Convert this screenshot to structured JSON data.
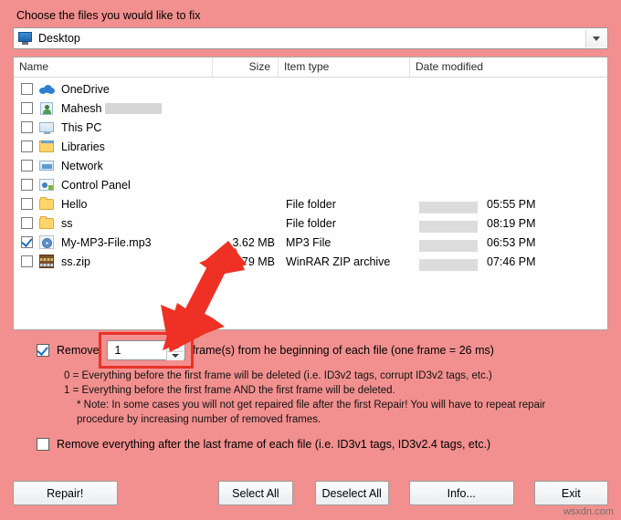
{
  "dialog": {
    "prompt": "Choose the files you would like to fix",
    "location": {
      "value": "Desktop",
      "icon": "monitor-icon",
      "dropdown_icon": "chevron-down-icon"
    },
    "columns": {
      "name": "Name",
      "size": "Size",
      "type": "Item type",
      "date": "Date modified"
    },
    "files": [
      {
        "checked": false,
        "icon": "onedrive-icon",
        "name": "OneDrive",
        "name_blurred": false,
        "size": "",
        "type": "",
        "date": "",
        "date_blurred": false
      },
      {
        "checked": false,
        "icon": "user-folder-icon",
        "name": "Mahesh",
        "name_blurred": true,
        "size": "",
        "type": "",
        "date": "",
        "date_blurred": false
      },
      {
        "checked": false,
        "icon": "this-pc-icon",
        "name": "This PC",
        "name_blurred": false,
        "size": "",
        "type": "",
        "date": "",
        "date_blurred": false
      },
      {
        "checked": false,
        "icon": "libraries-icon",
        "name": "Libraries",
        "name_blurred": false,
        "size": "",
        "type": "",
        "date": "",
        "date_blurred": false
      },
      {
        "checked": false,
        "icon": "network-icon",
        "name": "Network",
        "name_blurred": false,
        "size": "",
        "type": "",
        "date": "",
        "date_blurred": false
      },
      {
        "checked": false,
        "icon": "control-panel-icon",
        "name": "Control Panel",
        "name_blurred": false,
        "size": "",
        "type": "",
        "date": "",
        "date_blurred": false
      },
      {
        "checked": false,
        "icon": "folder-icon",
        "name": "Hello",
        "name_blurred": false,
        "size": "",
        "type": "File folder",
        "date": "05:55 PM",
        "date_blurred": true
      },
      {
        "checked": false,
        "icon": "folder-icon",
        "name": "ss",
        "name_blurred": false,
        "size": "",
        "type": "File folder",
        "date": "08:19 PM",
        "date_blurred": true
      },
      {
        "checked": true,
        "icon": "mp3-file-icon",
        "name": "My-MP3-File.mp3",
        "name_blurred": false,
        "size": "3.62 MB",
        "type": "MP3 File",
        "date": "06:53 PM",
        "date_blurred": true
      },
      {
        "checked": false,
        "icon": "zip-archive-icon",
        "name": "ss.zip",
        "name_blurred": false,
        "size": "2.79 MB",
        "type": "WinRAR ZIP archive",
        "date": "07:46 PM",
        "date_blurred": true
      }
    ],
    "remove_frames": {
      "checked": true,
      "label_before": "Remove",
      "value": "1",
      "label_after": "frame(s) from he beginning of each file (one frame = 26 ms)",
      "spinner_up_icon": "spinner-up-icon",
      "spinner_down_icon": "spinner-down-icon",
      "highlight_color": "#e8322a"
    },
    "notes": [
      "0 = Everything before the first frame will be deleted (i.e. ID3v2 tags, corrupt ID3v2 tags, etc.)",
      "1 = Everything before the first frame AND the first frame will be deleted.",
      "* Note: In some cases you will not get repaired file after the first Repair! You will have to repeat repair",
      "procedure by increasing number of removed frames."
    ],
    "remove_after_last": {
      "checked": false,
      "label": "Remove everything after the last frame of each file (i.e. ID3v1 tags, ID3v2.4 tags, etc.)"
    },
    "buttons": {
      "repair": "Repair!",
      "select_all": "Select All",
      "deselect_all": "Deselect All",
      "info": "Info...",
      "exit": "Exit"
    },
    "annotation": {
      "arrow_icon": "red-arrow-icon",
      "arrow_color": "#ee3124"
    },
    "watermark": "wsxdn.com"
  }
}
